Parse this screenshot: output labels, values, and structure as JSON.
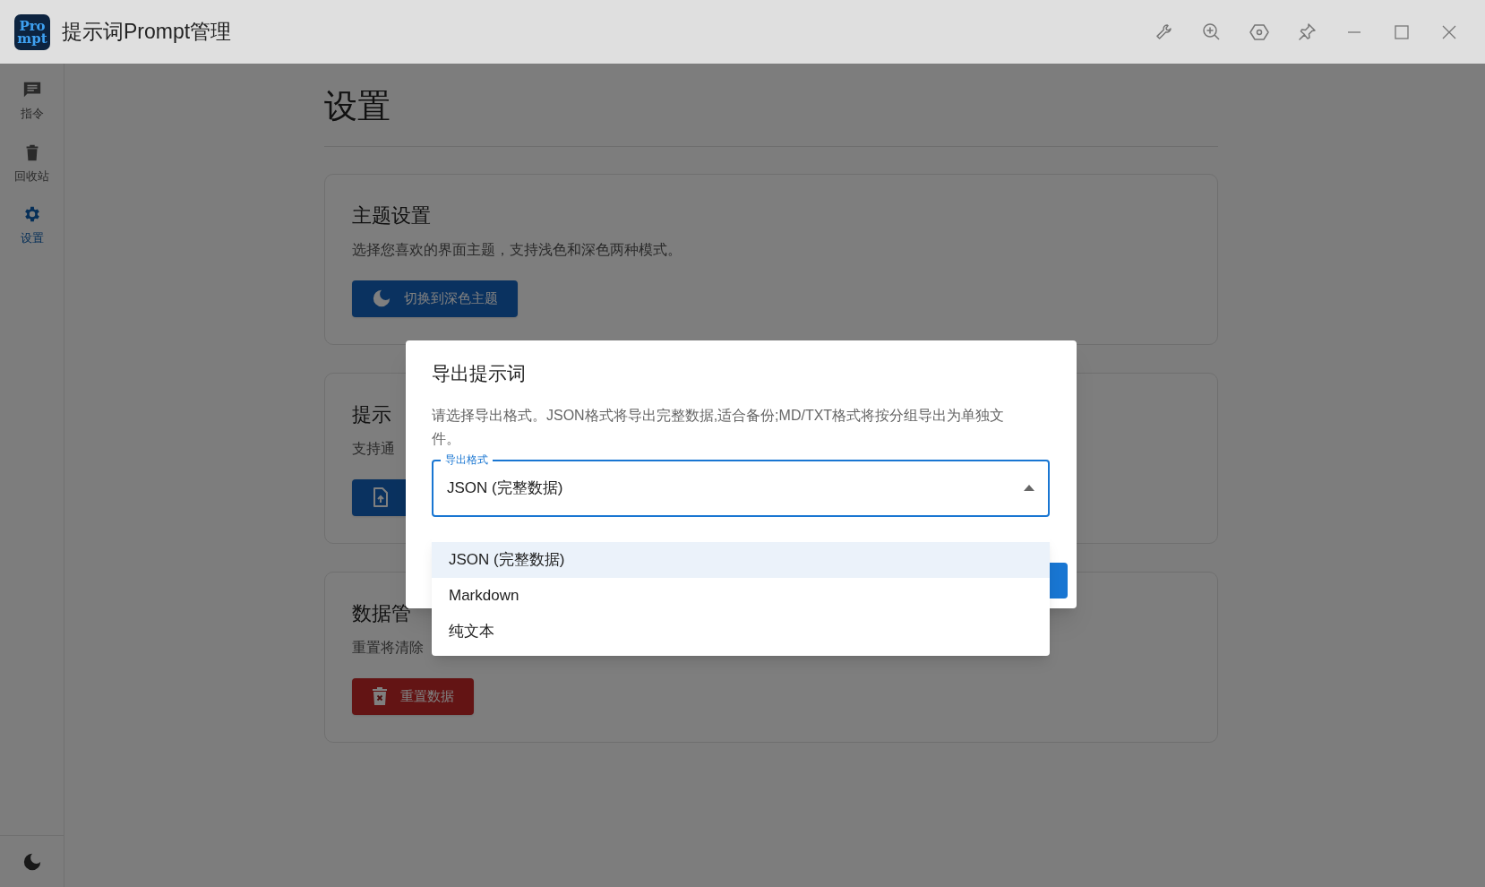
{
  "app": {
    "title": "提示词Prompt管理",
    "logo": [
      "Pro",
      "mpt"
    ]
  },
  "sidebar": {
    "items": [
      {
        "label": "指令",
        "selected": false
      },
      {
        "label": "回收站",
        "selected": false
      },
      {
        "label": "设置",
        "selected": true
      }
    ]
  },
  "page": {
    "heading": "设置"
  },
  "cards": [
    {
      "title": "主题设置",
      "description": "选择您喜欢的界面主题，支持浅色和深色两种模式。",
      "button": {
        "label": "切换到深色主题",
        "kind": "primary"
      }
    },
    {
      "title": "提示",
      "description": "支持通",
      "button": {
        "kind": "primary"
      }
    },
    {
      "title": "数据管",
      "description": "重置将清除",
      "button": {
        "label": "重置数据",
        "kind": "danger"
      }
    }
  ],
  "dialog": {
    "title": "导出提示词",
    "description": "请选择导出格式。JSON格式将导出完整数据,适合备份;MD/TXT格式将按分组导出为单独文件。",
    "select": {
      "label": "导出格式",
      "value": "JSON (完整数据)",
      "expanded": true
    },
    "options": [
      {
        "label": "JSON (完整数据)",
        "selected": true
      },
      {
        "label": "Markdown",
        "selected": false
      },
      {
        "label": "纯文本",
        "selected": false
      }
    ]
  }
}
